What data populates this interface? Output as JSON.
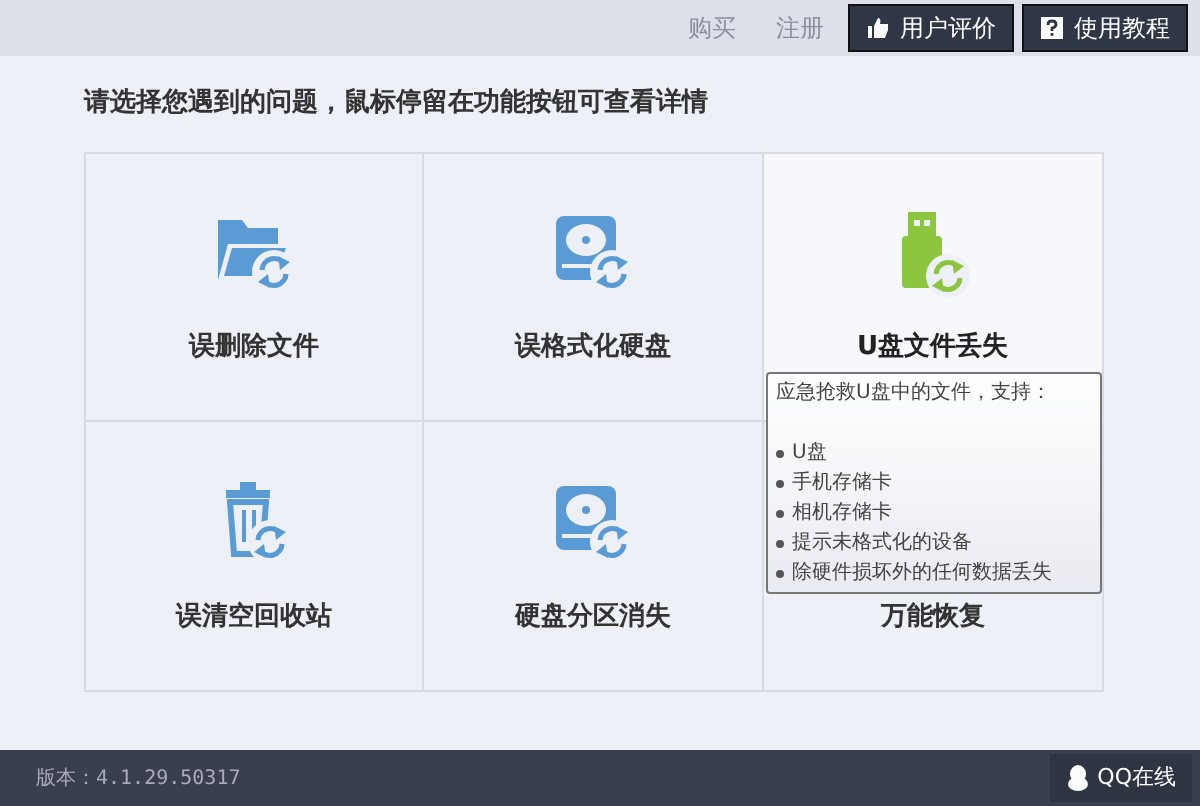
{
  "top_bar": {
    "links": [
      "购买",
      "注册"
    ],
    "buttons": [
      {
        "label": "用户评价",
        "kind": "thumb"
      },
      {
        "label": "使用教程",
        "kind": "help"
      }
    ]
  },
  "heading": "请选择您遇到的问题，鼠标停留在功能按钮可查看详情",
  "tiles": [
    {
      "label": "误删除文件",
      "kind": "folder",
      "highlighted": false
    },
    {
      "label": "误格式化硬盘",
      "kind": "disk",
      "highlighted": false
    },
    {
      "label": "U盘文件丢失",
      "kind": "usb",
      "highlighted": true
    },
    {
      "label": "误清空回收站",
      "kind": "trash",
      "highlighted": false
    },
    {
      "label": "硬盘分区消失",
      "kind": "partition",
      "highlighted": false
    },
    {
      "label": "万能恢复",
      "highlighted": false
    }
  ],
  "tooltip": {
    "title": "应急抢救U盘中的文件，支持：",
    "items": [
      "U盘",
      "手机存储卡",
      "相机存储卡",
      "提示未格式化的设备",
      "除硬件损坏外的任何数据丢失"
    ]
  },
  "status_bar": {
    "version": "版本：4.1.29.50317",
    "qq_button": "QQ在线"
  }
}
